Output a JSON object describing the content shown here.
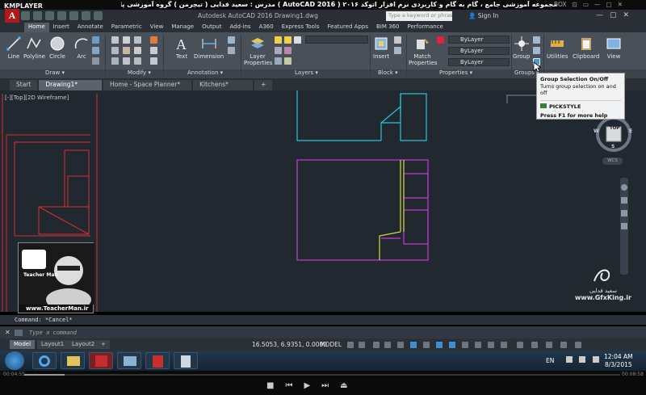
{
  "player": {
    "logo": "KMPLAYER",
    "title": "مجموعه آموزشی جامع ، گام به گام و کاربردی نرم افزار اتوکد ۲۰۱۶ ( 2016 AutoCAD )   مدرس : سعید فدایی ( تیچرمن ) گروه آموزشی پادشاه گرافیست ها",
    "controls": [
      "BOX",
      "⊡",
      "▭",
      "—",
      "▢",
      "✕"
    ],
    "time_elapsed": "00:04:55",
    "time_total": "00:08:58",
    "progress": 0.068
  },
  "acad": {
    "app_letter": "A",
    "doc_title": "Autodesk AutoCAD 2016    Drawing1.dwg",
    "search_placeholder": "Type a keyword or phrase",
    "sign_in": "Sign In",
    "window_controls": [
      "—",
      "▢",
      "✕"
    ]
  },
  "ribbon_tabs": [
    "Home",
    "Insert",
    "Annotate",
    "Parametric",
    "View",
    "Manage",
    "Output",
    "Add-ins",
    "A360",
    "Express Tools",
    "Featured Apps",
    "BIM 360",
    "Performance"
  ],
  "ribbon": {
    "draw": {
      "line": "Line",
      "polyline": "Polyline",
      "circle": "Circle",
      "arc": "Arc",
      "label": "Draw ▾"
    },
    "modify": {
      "label": "Modify ▾"
    },
    "annotation": {
      "text": "Text",
      "dimension": "Dimension",
      "label": "Annotation ▾"
    },
    "layers": {
      "layer_properties": "Layer Properties",
      "label": "Layers ▾"
    },
    "block": {
      "insert": "Insert",
      "label": "Block ▾"
    },
    "properties": {
      "match": "Match Properties",
      "bylayer1": "ByLayer",
      "bylayer2": "ByLayer",
      "bylayer3": "ByLayer",
      "label": "Properties ▾"
    },
    "groups": {
      "group": "Group",
      "label": "Groups ▾"
    },
    "utilities": "Utilities",
    "clipboard": "Clipboard",
    "view": "View"
  },
  "file_tabs": [
    "Start",
    "Drawing1*",
    "Home - Space Planner*",
    "Kitchens*",
    "+"
  ],
  "viewport_label": "[-][Top][2D Wireframe]",
  "tooltip": {
    "title": "Group Selection On/Off",
    "desc": "Turns group selection on and off",
    "command": "PICKSTYLE",
    "help": "Press F1 for more help"
  },
  "viewcube": {
    "top": "TOP",
    "n": "N",
    "s": "S",
    "e": "E",
    "w": "W",
    "wcs": "WCS"
  },
  "watermark": {
    "name": "سعید فدایی",
    "url": "www.GfxKing.ir"
  },
  "teacher": {
    "url": "www.TeacherMan.ir",
    "name": "Teacher Man"
  },
  "command": {
    "history": "Command: *Cancel*",
    "placeholder": "Type a command"
  },
  "layout_tabs": [
    "Model",
    "Layout1",
    "Layout2",
    "+"
  ],
  "status": {
    "coords": "16.5053, 6.9351, 0.0000",
    "model": "MODEL"
  },
  "taskbar": {
    "lang": "EN",
    "time": "12:04 AM",
    "date": "8/3/2015"
  },
  "colors": {
    "cyan": "#29c6d6",
    "magenta": "#c23bd6",
    "yellow": "#d8d83a",
    "red": "#d62f2f",
    "accent_red": "#b0171f"
  }
}
